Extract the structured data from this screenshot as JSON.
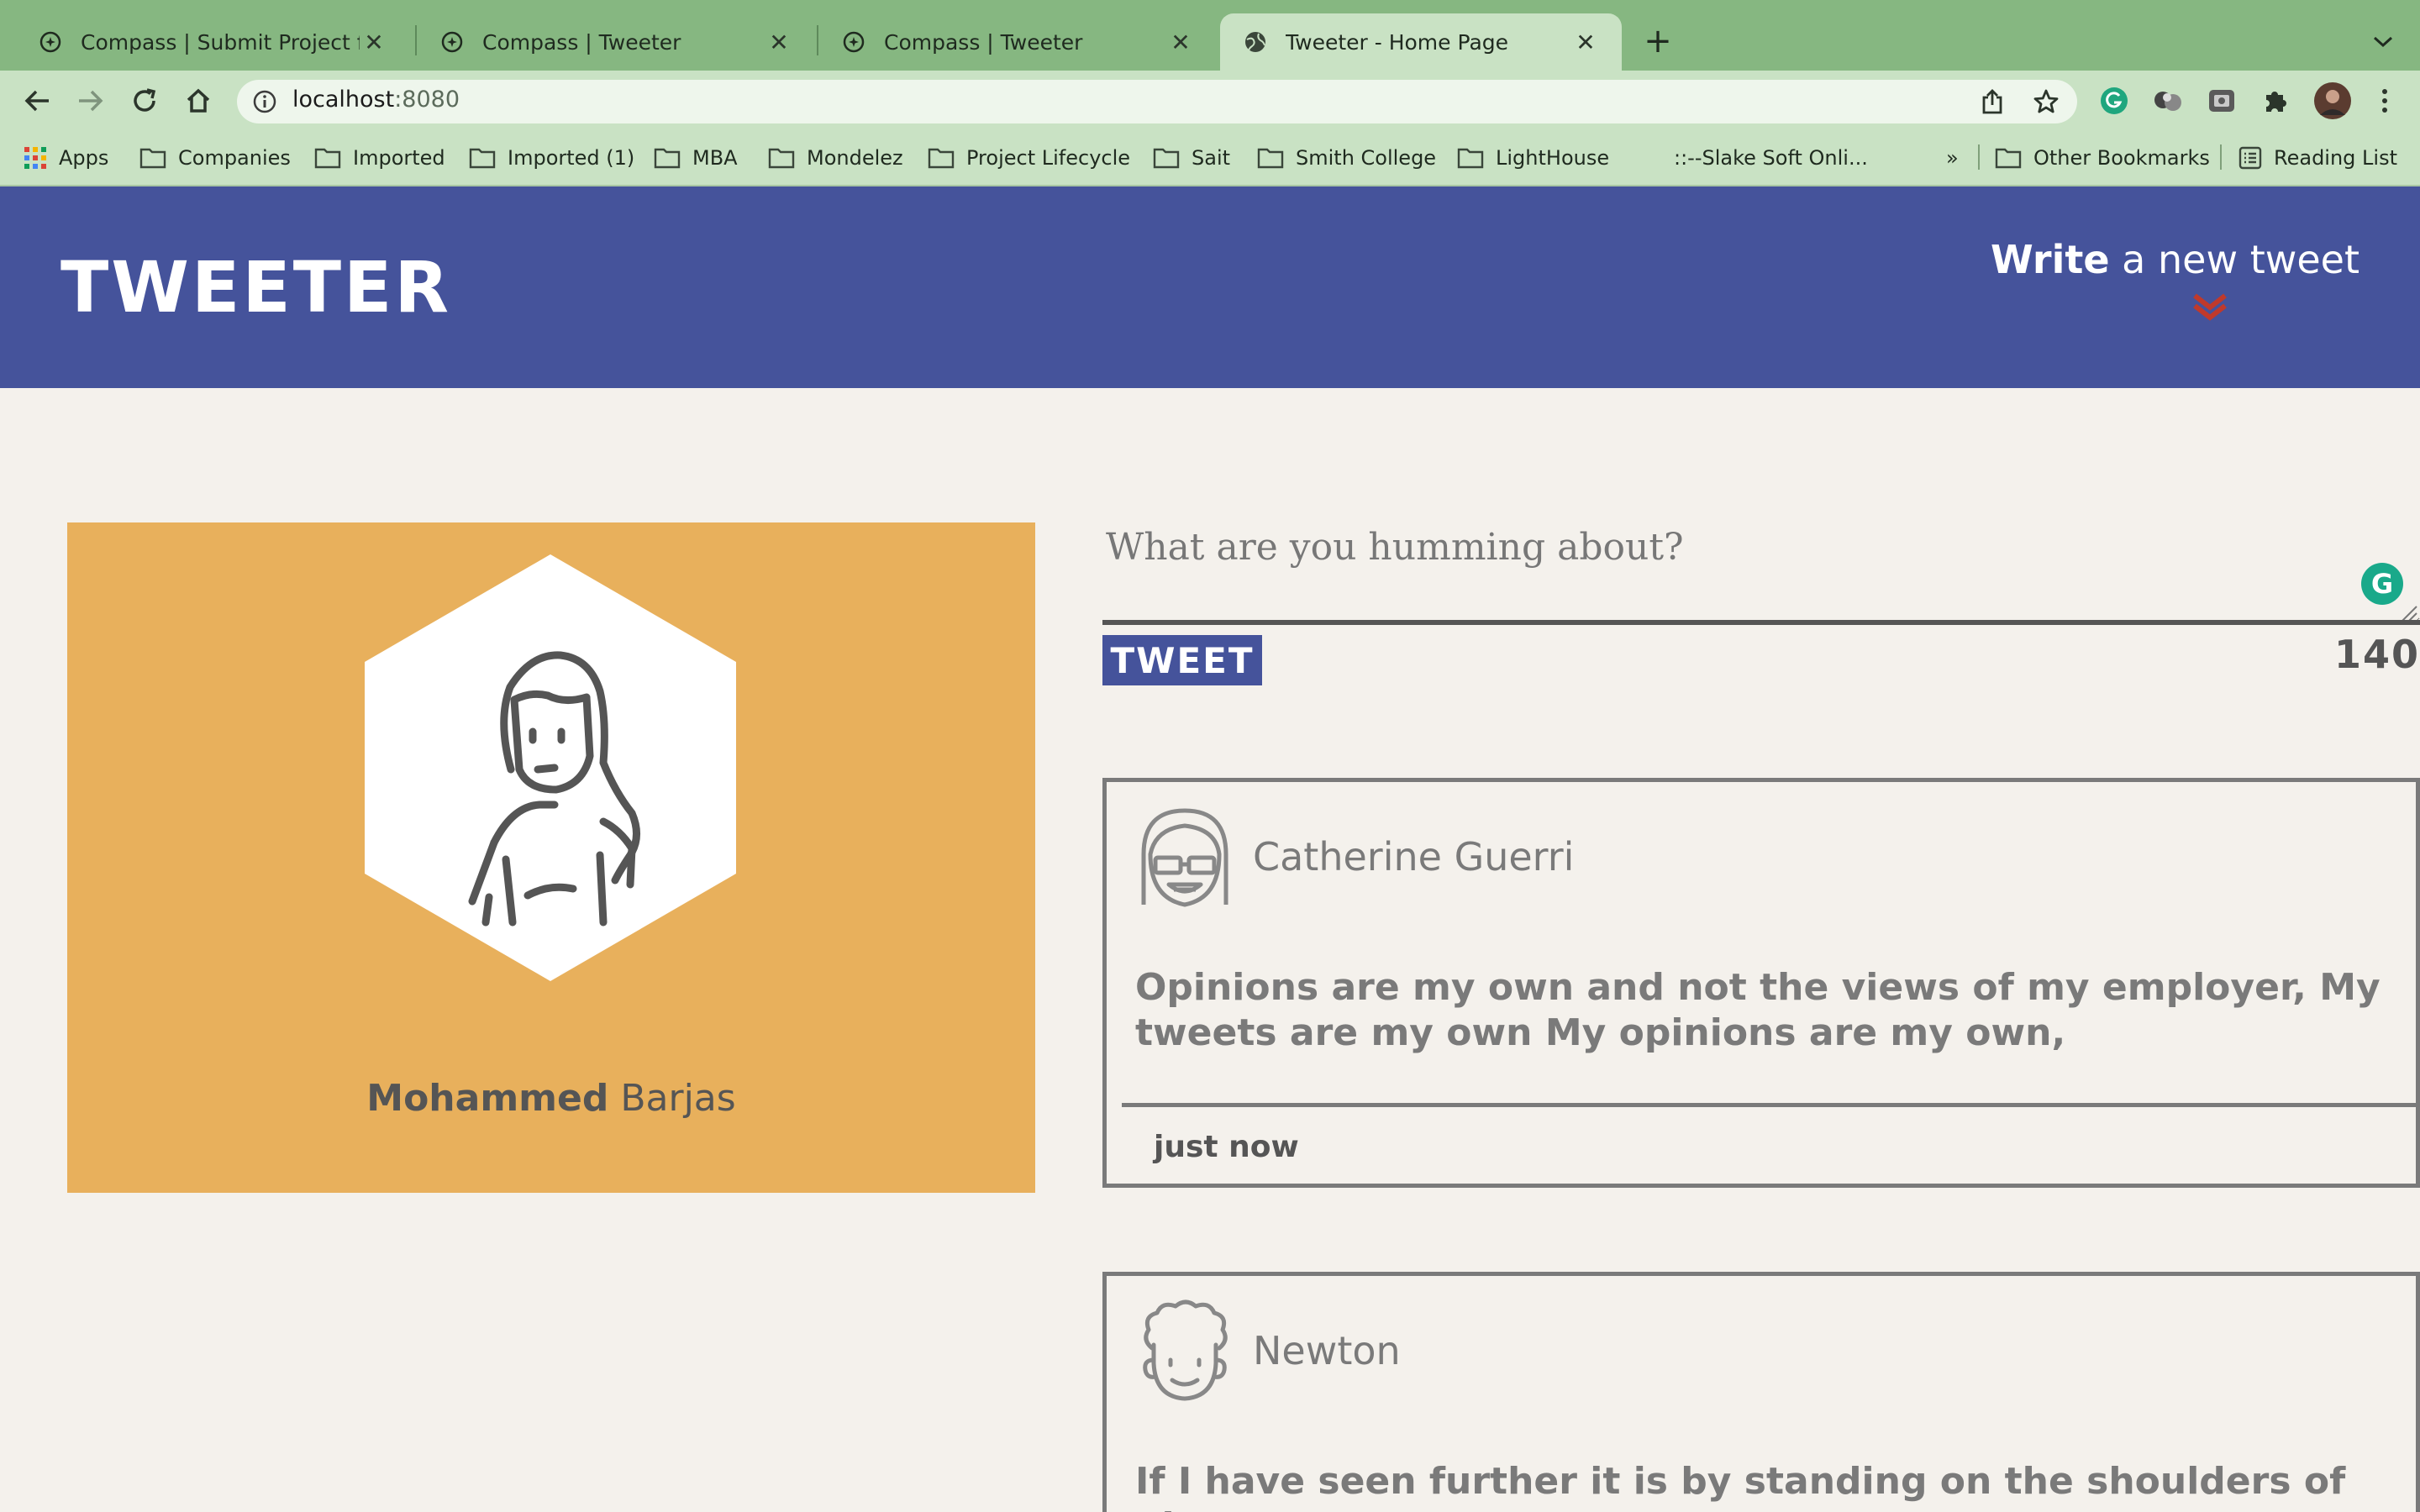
{
  "browser": {
    "tabs": [
      {
        "title": "Compass | Submit Project for E",
        "active": false
      },
      {
        "title": "Compass | Tweeter",
        "active": false
      },
      {
        "title": "Compass | Tweeter",
        "active": false
      },
      {
        "title": "Tweeter - Home Page",
        "active": true
      }
    ],
    "url_host": "localhost",
    "url_port": ":8080",
    "bookmarks": [
      "Apps",
      "Companies",
      "Imported",
      "Imported (1)",
      "MBA",
      "Mondelez",
      "Project Lifecycle",
      "Sait",
      "Smith College",
      "LightHouse",
      "::--Slake Soft Onli...",
      "»",
      "Other Bookmarks",
      "Reading List"
    ],
    "colors": {
      "tabbar": "#86b781",
      "toolbar": "#c9e2c4"
    }
  },
  "header": {
    "brand": "TWEETER",
    "write_bold": "Write",
    "write_rest": " a new tweet",
    "color": "#45539b"
  },
  "profile": {
    "first_name": "Mohammed",
    "last_name": " Barjas",
    "card_color": "#e8b05c"
  },
  "compose": {
    "placeholder": "What are you humming about?",
    "button_label": "TWEET",
    "counter": "140"
  },
  "tweets": [
    {
      "author": "Catherine Guerri",
      "avatar_icon": "woman-with-glasses-avatar-icon",
      "content": "Opinions are my own and not the views of my employer, My tweets are my own My opinions are my own,",
      "time": "just now"
    },
    {
      "author": "Newton",
      "avatar_icon": "curly-hair-man-avatar-icon",
      "content": "If I have seen further it is by standing on the shoulders of giants",
      "time": ""
    }
  ]
}
